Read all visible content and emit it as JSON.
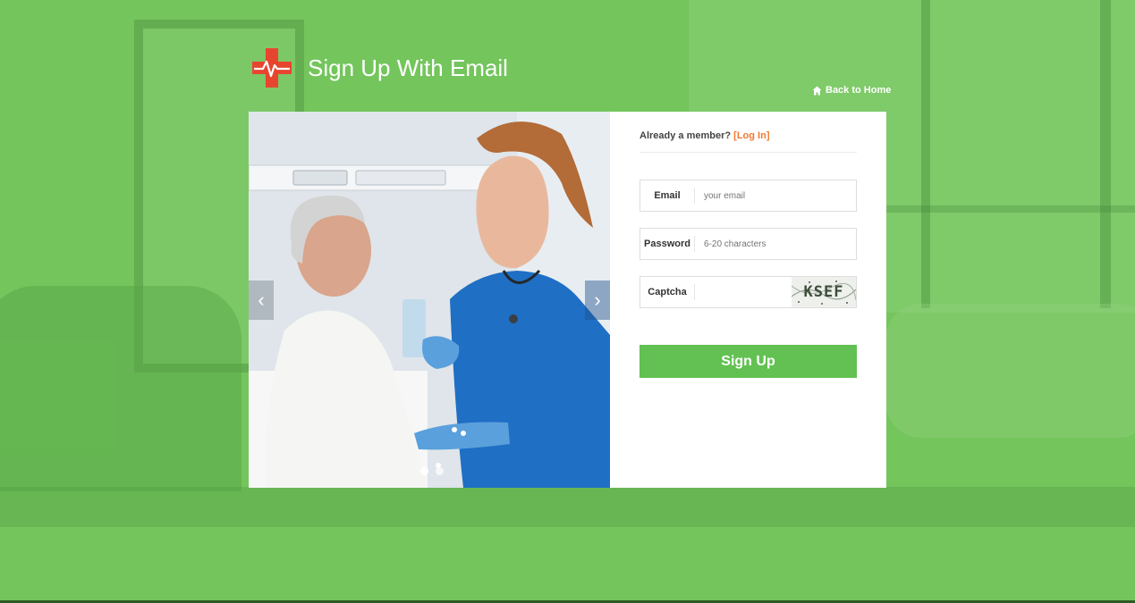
{
  "header": {
    "title": "Sign Up With Email",
    "back_home": "Back to Home"
  },
  "form": {
    "already_member": "Already a member?",
    "login_link": "[Log In]",
    "fields": [
      {
        "label": "Email",
        "placeholder": "your email",
        "value": ""
      },
      {
        "label": "Password",
        "placeholder": "6-20 characters",
        "value": ""
      },
      {
        "label": "Captcha",
        "placeholder": "",
        "value": ""
      }
    ],
    "captcha_text": "KSEF",
    "submit_label": "Sign Up"
  },
  "carousel": {
    "prev_glyph": "‹",
    "next_glyph": "›",
    "slide_count": 2,
    "active_slide": 1
  },
  "colors": {
    "background": "#73c55c",
    "button": "#62c152",
    "link": "#f07830",
    "logo": "#e8452f"
  }
}
